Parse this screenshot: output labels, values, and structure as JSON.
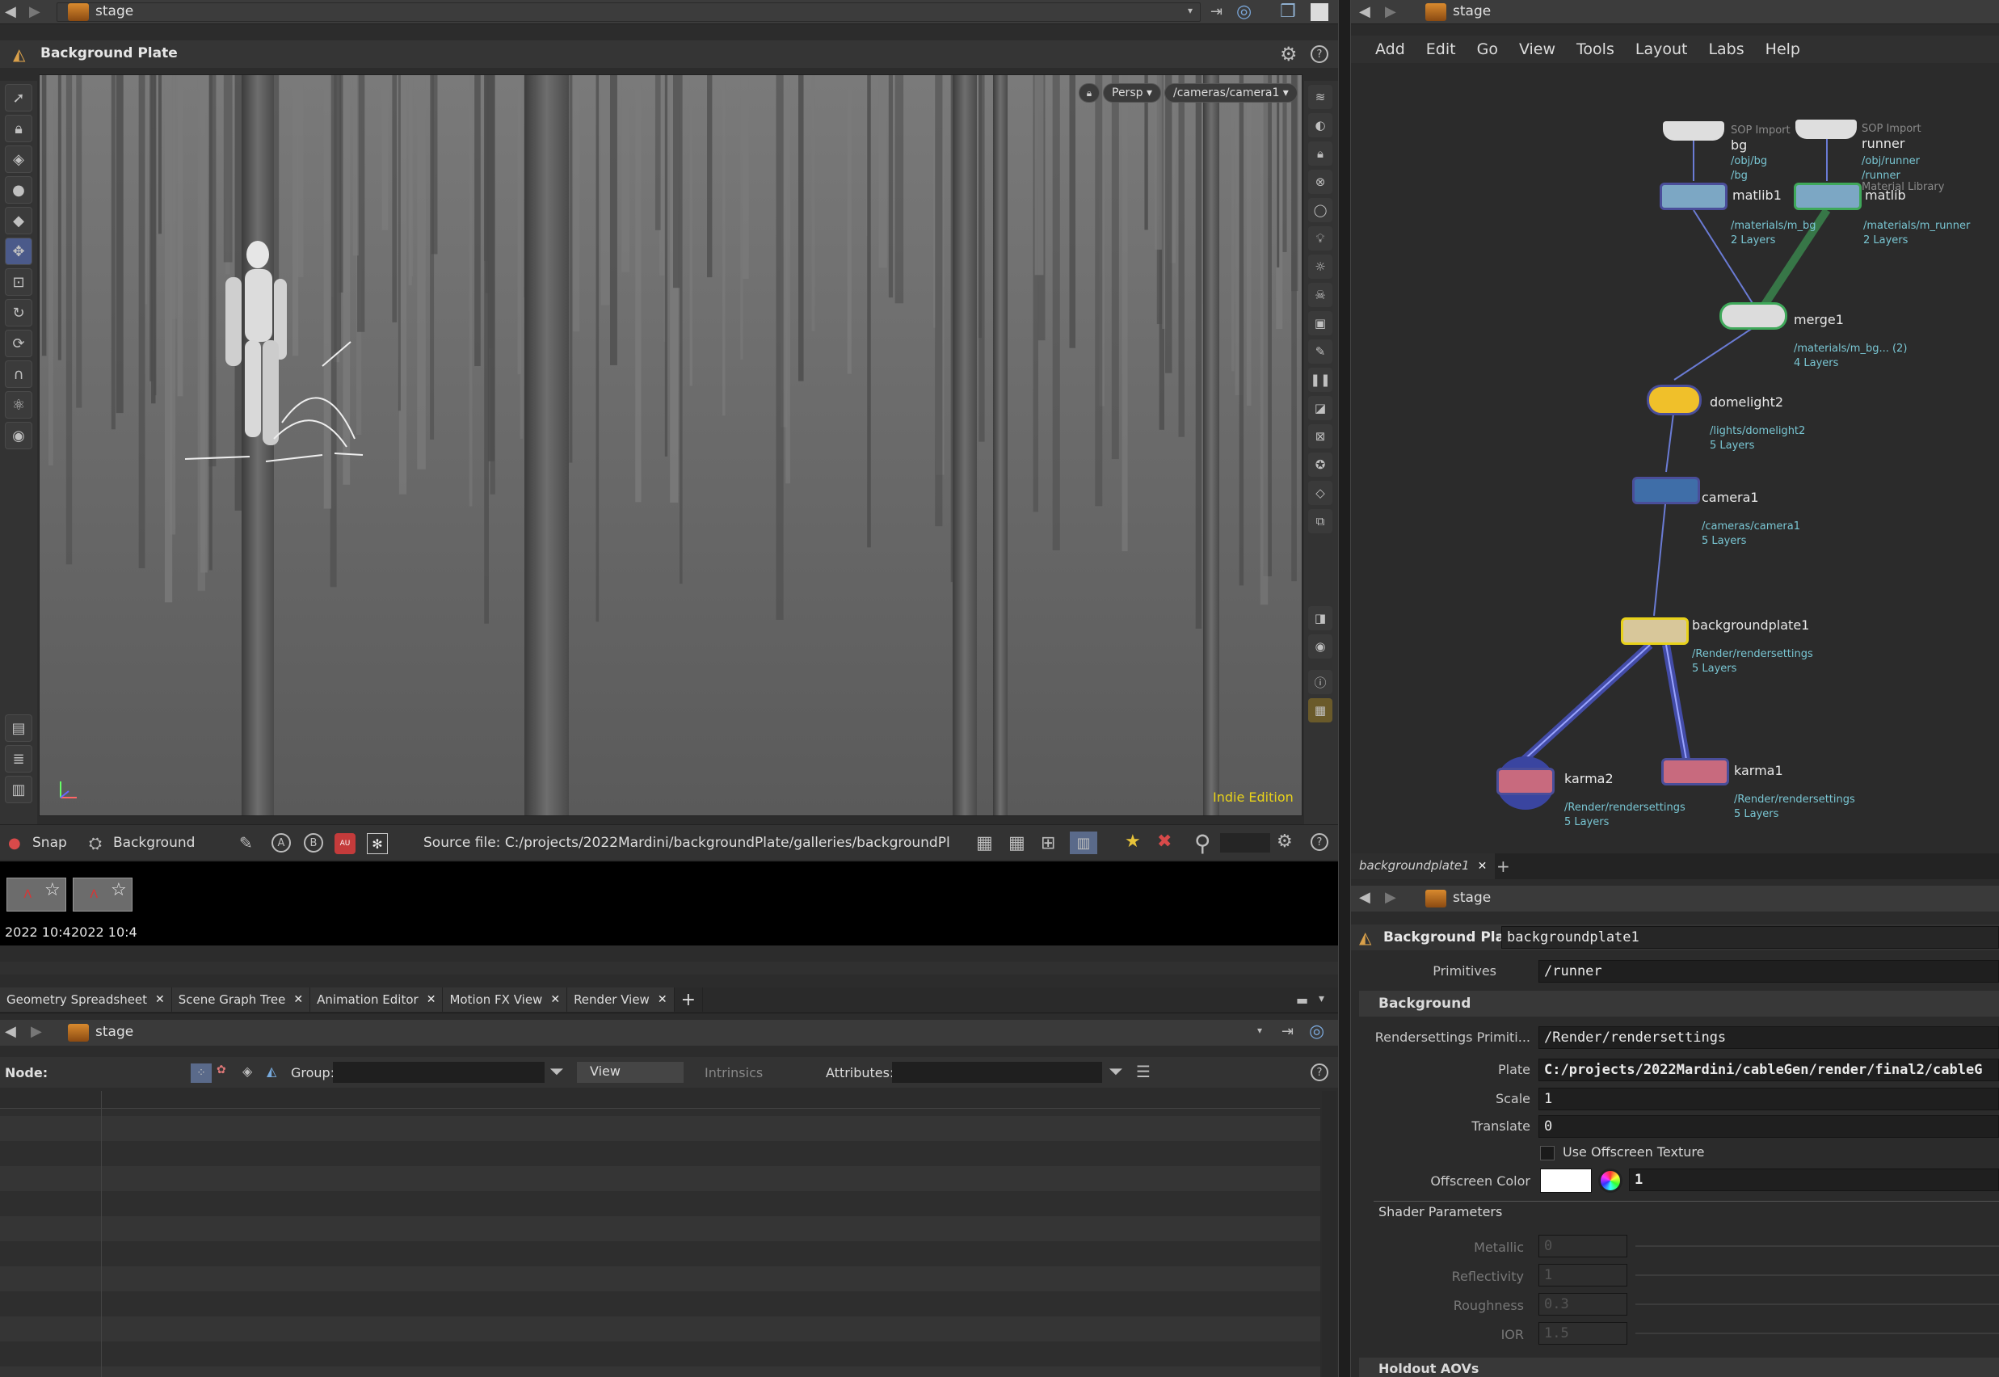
{
  "viewport_pane": {
    "path": "stage",
    "title": "Background Plate",
    "camera_persp": "Persp",
    "camera_path": "/cameras/camera1",
    "edition": "Indie Edition"
  },
  "gallery_bar": {
    "snap": "Snap",
    "background": "Background",
    "source_file": "Source file: C:/projects/2022Mardini/backgroundPlate/galleries/backgroundPl",
    "thumb1_label": "2022 10:4",
    "thumb2_label": "2022 10:4"
  },
  "bottom_tabs": [
    {
      "label": "Geometry Spreadsheet"
    },
    {
      "label": "Scene Graph Tree"
    },
    {
      "label": "Animation Editor"
    },
    {
      "label": "Motion FX View"
    },
    {
      "label": "Render View"
    }
  ],
  "spreadsheet": {
    "path": "stage",
    "node_label": "Node:",
    "group_label": "Group:",
    "view_label": "View",
    "intrinsics_label": "Intrinsics",
    "attributes_label": "Attributes:"
  },
  "network": {
    "path": "stage",
    "menu": [
      "Add",
      "Edit",
      "Go",
      "View",
      "Tools",
      "Layout",
      "Labs",
      "Help"
    ],
    "nodes": {
      "bg": {
        "type": "SOP Import",
        "name": "bg",
        "sub1": "/obj/bg",
        "sub2": "/bg"
      },
      "runner": {
        "type": "SOP Import",
        "name": "runner",
        "sub1": "/obj/runner",
        "sub2": "/runner"
      },
      "matlib1": {
        "type": "Material Library",
        "name": "matlib1",
        "sub1": "/materials/m_bg",
        "sub2": "2 Layers"
      },
      "matlib": {
        "type": "Material Library",
        "name": "matlib",
        "sub1": "/materials/m_runner",
        "sub2": "2 Layers"
      },
      "merge1": {
        "name": "merge1",
        "sub1": "/materials/m_bg... (2)",
        "sub2": "4 Layers"
      },
      "domelight2": {
        "name": "domelight2",
        "sub1": "/lights/domelight2",
        "sub2": "5 Layers"
      },
      "camera1": {
        "name": "camera1",
        "sub1": "/cameras/camera1",
        "sub2": "5 Layers"
      },
      "backgroundplate1": {
        "name": "backgroundplate1",
        "sub1": "/Render/rendersettings",
        "sub2": "5 Layers"
      },
      "karma2": {
        "name": "karma2",
        "sub1": "/Render/rendersettings",
        "sub2": "5 Layers"
      },
      "karma1": {
        "name": "karma1",
        "sub1": "/Render/rendersettings",
        "sub2": "5 Layers"
      }
    }
  },
  "params": {
    "tab": "backgroundplate1",
    "path": "stage",
    "node_type": "Background Plate",
    "node_name": "backgroundplate1",
    "primitives_label": "Primitives",
    "primitives_value": "/runner",
    "background_section": "Background",
    "rendersettings_label": "Rendersettings Primiti...",
    "rendersettings_value": "/Render/rendersettings",
    "plate_label": "Plate",
    "plate_value": "C:/projects/2022Mardini/cableGen/render/final2/cableG",
    "scale_label": "Scale",
    "scale_value": "1",
    "translate_label": "Translate",
    "translate_value": "0",
    "offscreen_texture_label": "Use Offscreen Texture",
    "offscreen_color_label": "Offscreen Color",
    "offscreen_color_value": "1",
    "shader_section": "Shader Parameters",
    "metallic_label": "Metallic",
    "metallic_value": "0",
    "reflectivity_label": "Reflectivity",
    "reflectivity_value": "1",
    "roughness_label": "Roughness",
    "roughness_value": "0.3",
    "ior_label": "IOR",
    "ior_value": "1.5",
    "holdout_section": "Holdout AOVs"
  },
  "colors": {
    "accent_yellow": "#e8d21a",
    "wire_green": "#3fa85a",
    "wire_blue": "#4a55c8",
    "path_cyan": "#79c6d3"
  }
}
